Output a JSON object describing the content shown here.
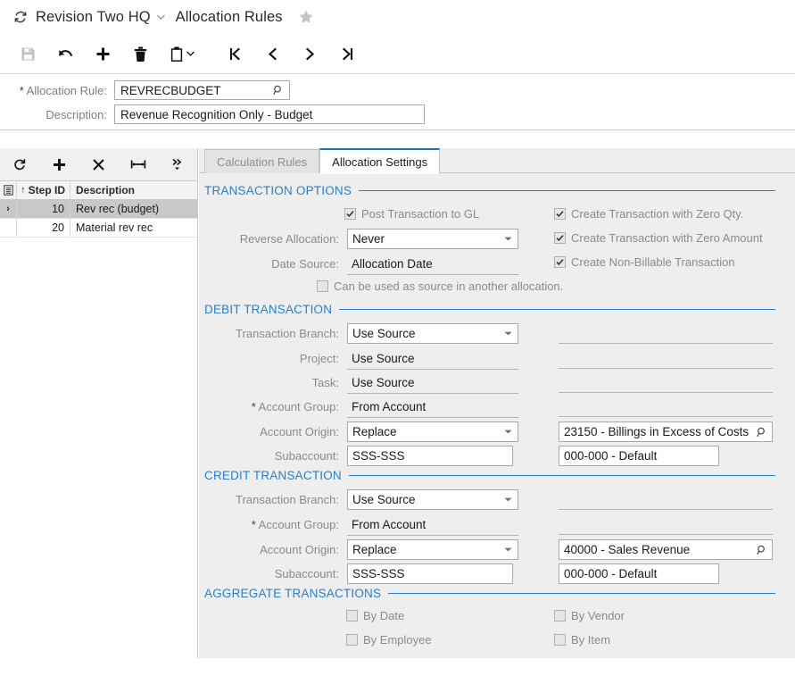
{
  "titlebar": {
    "refresh_icon": "refresh-icon",
    "company": "Revision Two HQ",
    "company_caret": "chevron-down-icon",
    "screen": "Allocation Rules",
    "favorite_icon": "star-icon"
  },
  "toolbar": {
    "buttons": [
      {
        "name": "save-button",
        "icon": "save-icon",
        "disabled": true
      },
      {
        "name": "undo-button",
        "icon": "undo-icon",
        "disabled": false
      },
      {
        "name": "add-new-record-button",
        "icon": "plus-icon",
        "disabled": false
      },
      {
        "name": "delete-record-button",
        "icon": "trash-icon",
        "disabled": false
      },
      {
        "name": "clipboard-actions-button",
        "icon": "clipboard-icon",
        "disabled": false,
        "has_caret": true
      },
      {
        "name": "first-record-button",
        "icon": "first-page-icon",
        "disabled": false
      },
      {
        "name": "previous-record-button",
        "icon": "chevron-left-icon",
        "disabled": false
      },
      {
        "name": "next-record-button",
        "icon": "chevron-right-icon",
        "disabled": false
      },
      {
        "name": "last-record-button",
        "icon": "last-page-icon",
        "disabled": false
      }
    ]
  },
  "form_header": {
    "allocation_rule_label": "Allocation Rule:",
    "allocation_rule_value": "REVRECBUDGET",
    "allocation_rule_placeholder": "",
    "allocation_rule_selector_icon": "magnifier-icon",
    "description_label": "Description:",
    "description_value": "Revenue Recognition Only - Budget",
    "description_placeholder": ""
  },
  "steps_grid": {
    "toolbar": [
      {
        "name": "grid-refresh-button",
        "icon": "refresh-icon"
      },
      {
        "name": "grid-add-row-button",
        "icon": "plus-icon"
      },
      {
        "name": "grid-delete-row-button",
        "icon": "close-x-icon"
      },
      {
        "name": "grid-fit-columns-button",
        "icon": "fit-width-icon"
      },
      {
        "name": "grid-more-actions-button",
        "icon": "chevrons-right-icon"
      }
    ],
    "columns": {
      "select_icon": "column-config-icon",
      "step_id": "Step ID",
      "sort_arrow": "sort-asc-icon",
      "description": "Description"
    },
    "rows": [
      {
        "selected": true,
        "marker": "›",
        "step_id": "10",
        "description": "Rev rec (budget)"
      },
      {
        "selected": false,
        "marker": "",
        "step_id": "20",
        "description": "Material rev rec"
      }
    ]
  },
  "tabs": [
    {
      "name": "tab-calculation-rules",
      "label": "Calculation Rules",
      "active": false
    },
    {
      "name": "tab-allocation-settings",
      "label": "Allocation Settings",
      "active": true
    }
  ],
  "transaction_options": {
    "title": "TRANSACTION OPTIONS",
    "post_transaction_to_gl": {
      "label": "Post Transaction to GL",
      "checked": true
    },
    "reverse_allocation": {
      "label": "Reverse Allocation:",
      "value": "Never"
    },
    "date_source": {
      "label": "Date Source:",
      "value": "Allocation Date"
    },
    "can_be_used_as_source": {
      "label": "Can be used as source in another allocation.",
      "checked": false
    },
    "create_zero_qty": {
      "label": "Create Transaction with Zero Qty.",
      "checked": true
    },
    "create_zero_amount": {
      "label": "Create Transaction with Zero Amount",
      "checked": true
    },
    "create_non_billable": {
      "label": "Create Non-Billable Transaction",
      "checked": true
    }
  },
  "debit_transaction": {
    "title": "DEBIT TRANSACTION",
    "rows": [
      {
        "label": "Transaction Branch:",
        "required": false,
        "value": "Use Source",
        "style": "boxed-dropdown",
        "right_value": "",
        "right_style": "blank"
      },
      {
        "label": "Project:",
        "required": false,
        "value": "Use Source",
        "style": "flat",
        "right_value": "",
        "right_style": "blank"
      },
      {
        "label": "Task:",
        "required": false,
        "value": "Use Source",
        "style": "flat",
        "right_value": "",
        "right_style": "blank"
      },
      {
        "label": "Account Group:",
        "required": true,
        "value": "From Account",
        "style": "flat",
        "right_value": "",
        "right_style": "blank"
      },
      {
        "label": "Account Origin:",
        "required": false,
        "value": "Replace",
        "style": "boxed-dropdown",
        "right_value": "23150 - Billings in Excess of Costs",
        "right_style": "boxed-lookup"
      },
      {
        "label": "Subaccount:",
        "required": false,
        "value": "SSS-SSS",
        "style": "boxed",
        "right_value": "000-000 - Default",
        "right_style": "boxed-small"
      }
    ]
  },
  "credit_transaction": {
    "title": "CREDIT TRANSACTION",
    "rows": [
      {
        "label": "Transaction Branch:",
        "required": false,
        "value": "Use Source",
        "style": "boxed-dropdown",
        "right_value": "",
        "right_style": "blank"
      },
      {
        "label": "Account Group:",
        "required": true,
        "value": "From Account",
        "style": "flat",
        "right_value": "",
        "right_style": "blank"
      },
      {
        "label": "Account Origin:",
        "required": false,
        "value": "Replace",
        "style": "boxed-dropdown",
        "right_value": "40000 - Sales Revenue",
        "right_style": "boxed-lookup"
      },
      {
        "label": "Subaccount:",
        "required": false,
        "value": "SSS-SSS",
        "style": "boxed",
        "right_value": "000-000 - Default",
        "right_style": "boxed-small"
      }
    ]
  },
  "aggregate_transactions": {
    "title": "AGGREGATE TRANSACTIONS",
    "by_date": {
      "label": "By Date",
      "checked": false
    },
    "by_employee": {
      "label": "By Employee",
      "checked": false
    },
    "by_vendor": {
      "label": "By Vendor",
      "checked": false
    },
    "by_item": {
      "label": "By Item",
      "checked": false
    }
  },
  "colors": {
    "accent_blue": "#2a7fc9",
    "tab_active_top": "#1273c4",
    "panel_bg": "#eeeeee",
    "label_gray": "#8a8a8a",
    "selected_row": "#c8c8c8"
  }
}
